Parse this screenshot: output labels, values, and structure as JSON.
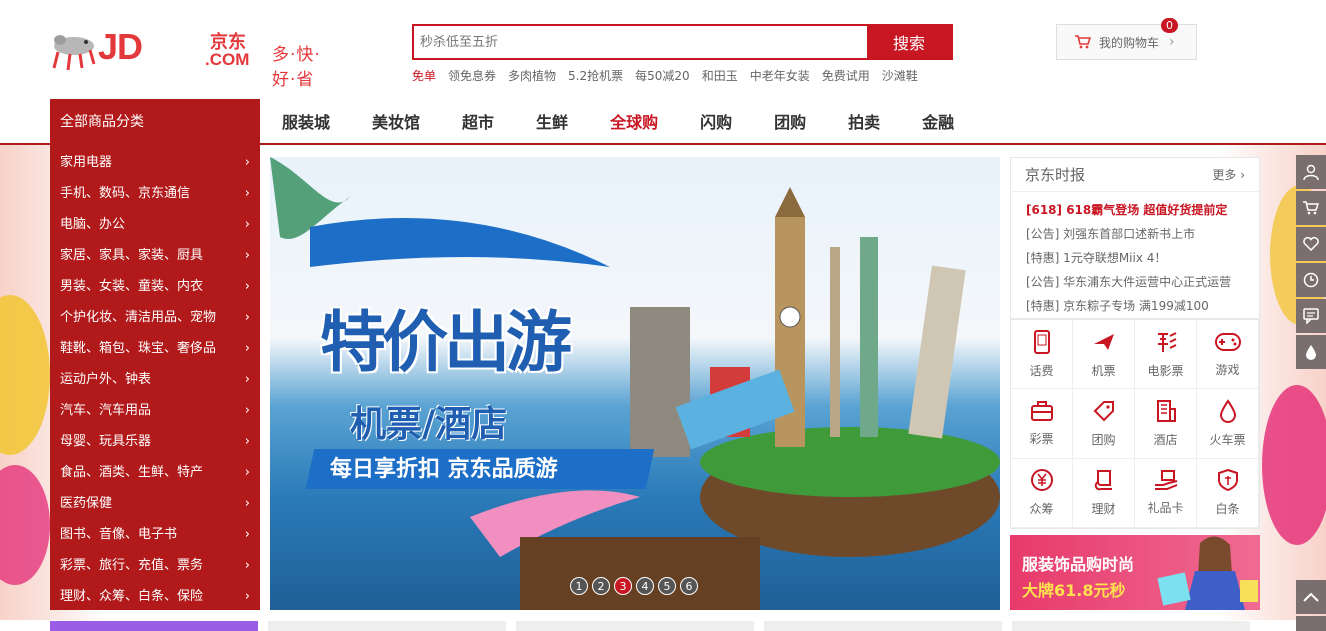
{
  "header": {
    "logo": {
      "brand": "JD",
      "brand_cn": "京东",
      "brand_com": ".COM",
      "slogan": "多·快·好·省"
    },
    "search": {
      "placeholder": "秒杀低至五折",
      "button_label": "搜索"
    },
    "hotwords": [
      "免单",
      "领免息券",
      "多肉植物",
      "5.2抢机票",
      "每50减20",
      "和田玉",
      "中老年女装",
      "免费试用",
      "沙滩鞋"
    ],
    "cart": {
      "label": "我的购物车",
      "count": "0"
    }
  },
  "nav": {
    "all_categories": "全部商品分类",
    "items": [
      {
        "label": "服装城"
      },
      {
        "label": "美妆馆"
      },
      {
        "label": "超市"
      },
      {
        "label": "生鲜"
      },
      {
        "label": "全球购",
        "active": true
      },
      {
        "label": "闪购"
      },
      {
        "label": "团购"
      },
      {
        "label": "拍卖"
      },
      {
        "label": "金融"
      }
    ]
  },
  "categories": [
    "家用电器",
    "手机、数码、京东通信",
    "电脑、办公",
    "家居、家具、家装、厨具",
    "男装、女装、童装、内衣",
    "个护化妆、清洁用品、宠物",
    "鞋靴、箱包、珠宝、奢侈品",
    "运动户外、钟表",
    "汽车、汽车用品",
    "母婴、玩具乐器",
    "食品、酒类、生鲜、特产",
    "医药保健",
    "图书、音像、电子书",
    "彩票、旅行、充值、票务",
    "理财、众筹、白条、保险"
  ],
  "banner": {
    "headline": "特价出游",
    "subline": "机票/酒店",
    "tagline": "每日享折扣 京东品质游",
    "dots": [
      "1",
      "2",
      "3",
      "4",
      "5",
      "6"
    ],
    "active_dot": 3
  },
  "news": {
    "title": "京东时报",
    "more": "更多",
    "items": [
      "[618] 618霸气登场 超值好货提前定",
      "[公告] 刘强东首部口述新书上市",
      "[特惠] 1元夺联想Miix 4！",
      "[公告] 华东浦东大件运营中心正式运营",
      "[特惠] 京东粽子专场 满199减100"
    ]
  },
  "services": [
    {
      "label": "话费",
      "icon": "phone-icon"
    },
    {
      "label": "机票",
      "icon": "plane-icon"
    },
    {
      "label": "电影票",
      "icon": "lottery-char-icon"
    },
    {
      "label": "游戏",
      "icon": "gamepad-icon"
    },
    {
      "label": "彩票",
      "icon": "briefcase-icon"
    },
    {
      "label": "团购",
      "icon": "tag-icon"
    },
    {
      "label": "酒店",
      "icon": "building-icon"
    },
    {
      "label": "火车票",
      "icon": "drop-icon"
    },
    {
      "label": "众筹",
      "icon": "yen-icon"
    },
    {
      "label": "理财",
      "icon": "scroll-icon"
    },
    {
      "label": "礼品卡",
      "icon": "gift-hand-icon"
    },
    {
      "label": "白条",
      "icon": "shield-icon"
    }
  ],
  "promo": {
    "line1": "服装饰品购时尚",
    "line2": "大牌61.8元秒"
  },
  "colors": {
    "brand_red": "#c81623",
    "category_bg": "#b1191a",
    "banner_blue": "#1f5eb0"
  }
}
